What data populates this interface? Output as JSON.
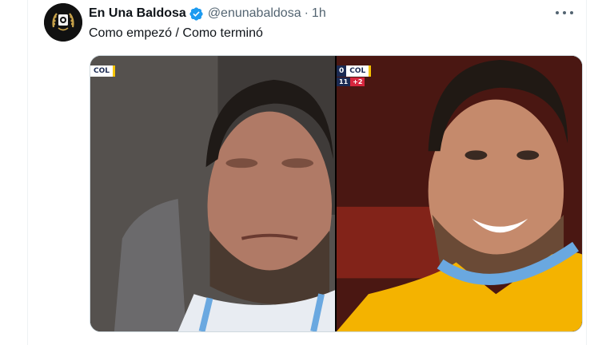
{
  "tweet": {
    "display_name": "En Una Baldosa",
    "handle": "@enunabaldosa",
    "separator": "·",
    "time": "1h",
    "text": "Como empezó / Como terminó",
    "verified": true,
    "accent": "#1d9bf0"
  },
  "icons": {
    "avatar": "soccer-ball-wreath-logo",
    "verified": "verified-badge-icon",
    "more": "more-horizontal-icon"
  },
  "media": {
    "left_scoreboard": {
      "team": "COL"
    },
    "right_scoreboard": {
      "score": "0",
      "team": "COL",
      "minute": "11",
      "added": "+2"
    }
  }
}
